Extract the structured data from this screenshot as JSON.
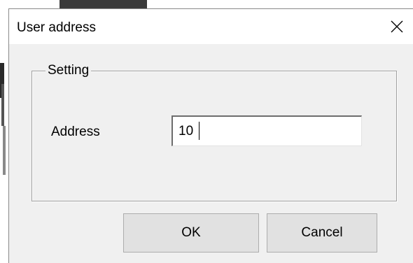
{
  "window": {
    "title": "User address",
    "close_icon": "close-icon"
  },
  "group": {
    "legend": "Setting"
  },
  "address": {
    "label": "Address",
    "value": "10"
  },
  "buttons": {
    "ok": "OK",
    "cancel": "Cancel"
  }
}
